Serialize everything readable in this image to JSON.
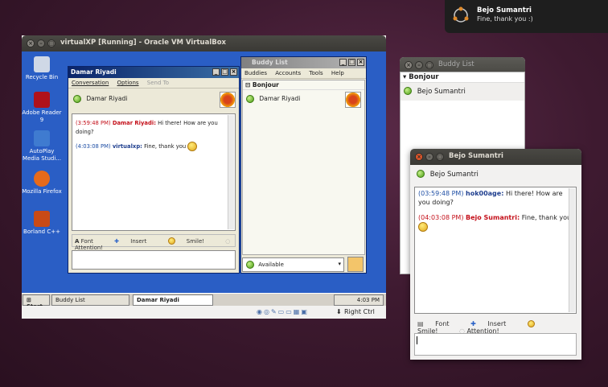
{
  "notification": {
    "title": "Bejo Sumantri",
    "message": "Fine, thank you :)"
  },
  "vbox": {
    "title": "virtualXP [Running] - Oracle VM VirtualBox",
    "host_key": "Right Ctrl",
    "desktop_icons": [
      {
        "label": "Recycle Bin",
        "color": "#cfd8e6"
      },
      {
        "label": "Adobe Reader 9",
        "color": "#b0121b"
      },
      {
        "label": "AutoPlay Media Studi...",
        "color": "#3f7bd0"
      },
      {
        "label": "Mozilla Firefox",
        "color": "#e66a1a"
      },
      {
        "label": "Borland C++",
        "color": "#c94a16"
      }
    ],
    "chat": {
      "title": "Damar Riyadi",
      "menu": [
        "Conversation",
        "Options",
        "Send To"
      ],
      "contact": "Damar Riyadi",
      "messages": [
        {
          "time": "(3:59:48 PM)",
          "sender": "Damar Riyadi:",
          "text": "Hi there! How are you doing?"
        },
        {
          "time": "(4:03:08 PM)",
          "sender": "virtualxp:",
          "text": "Fine, thank you"
        }
      ],
      "toolbar": {
        "font": "Font",
        "insert": "Insert",
        "smile": "Smile!",
        "attention": "Attention!"
      }
    },
    "buddylist": {
      "title": "Buddy List",
      "menu": [
        "Buddies",
        "Accounts",
        "Tools",
        "Help"
      ],
      "group": "Bonjour",
      "buddy": "Damar Riyadi",
      "status": "Available"
    },
    "taskbar": {
      "start": "Start",
      "tasks": [
        "Buddy List",
        "Damar Riyadi"
      ],
      "clock": "4:03 PM"
    }
  },
  "ubuntu_buddylist": {
    "title": "Buddy List",
    "group": "Bonjour",
    "buddy": "Bejo Sumantri"
  },
  "ubuntu_chat": {
    "title": "Bejo Sumantri",
    "contact": "Bejo Sumantri",
    "messages": [
      {
        "time": "(03:59:48 PM)",
        "sender": "hok00age:",
        "text": "Hi there! How are you doing?"
      },
      {
        "time": "(04:03:08 PM)",
        "sender": "Bejo Sumantri:",
        "text": "Fine, thank you"
      }
    ],
    "toolbar": {
      "font": "Font",
      "insert": "Insert",
      "smile": "Smile!",
      "attention": "Attention!"
    }
  }
}
